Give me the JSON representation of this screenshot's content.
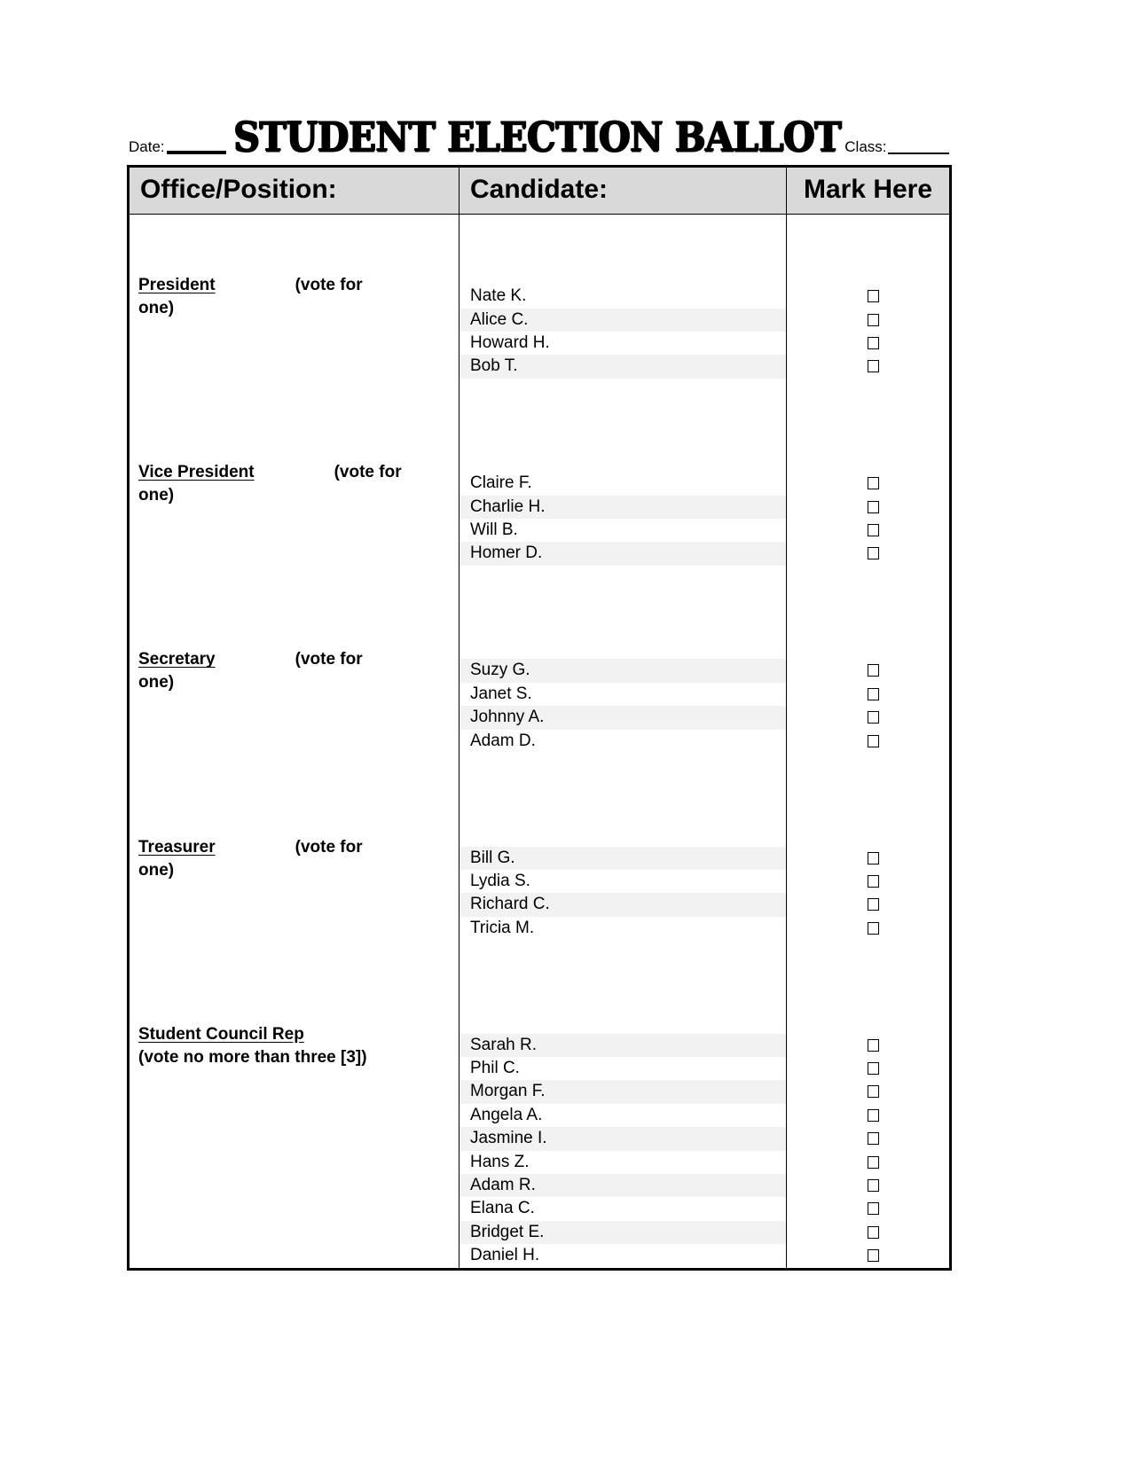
{
  "header": {
    "date_label": "Date:",
    "title": "STUDENT ELECTION BALLOT",
    "class_label": "Class:"
  },
  "table": {
    "columns": {
      "office": "Office/Position:",
      "candidate": "Candidate:",
      "mark": "Mark Here"
    },
    "sections": [
      {
        "office": "President",
        "note": "(vote for",
        "note_line2": "one)",
        "lead_spacers": 3,
        "candidates": [
          {
            "name": "Nate K.",
            "shaded": false
          },
          {
            "name": "Alice C.",
            "shaded": true
          },
          {
            "name": "Howard H.",
            "shaded": false
          },
          {
            "name": "Bob T.",
            "shaded": true
          }
        ]
      },
      {
        "office": "Vice President",
        "note": "(vote for",
        "note_line2": "one)",
        "lead_spacers": 4,
        "candidates": [
          {
            "name": "Claire F.",
            "shaded": false
          },
          {
            "name": "Charlie H.",
            "shaded": true
          },
          {
            "name": "Will B.",
            "shaded": false
          },
          {
            "name": "Homer D.",
            "shaded": true
          }
        ]
      },
      {
        "office": "Secretary",
        "note": "(vote for",
        "note_line2": "one)",
        "lead_spacers": 4,
        "candidates": [
          {
            "name": "Suzy G.",
            "shaded": true
          },
          {
            "name": "Janet S.",
            "shaded": false
          },
          {
            "name": "Johnny A.",
            "shaded": true
          },
          {
            "name": "Adam D.",
            "shaded": false
          }
        ]
      },
      {
        "office": "Treasurer",
        "note": "(vote for",
        "note_line2": "one)",
        "lead_spacers": 4,
        "candidates": [
          {
            "name": "Bill G.",
            "shaded": true
          },
          {
            "name": "Lydia S.",
            "shaded": false
          },
          {
            "name": "Richard C.",
            "shaded": true
          },
          {
            "name": "Tricia M.",
            "shaded": false
          }
        ]
      },
      {
        "office": "Student Council Rep",
        "note": "",
        "note_line2": "(vote no more than three [3])",
        "lead_spacers": 4,
        "candidates": [
          {
            "name": "Sarah R.",
            "shaded": true
          },
          {
            "name": "Phil C.",
            "shaded": false
          },
          {
            "name": "Morgan F.",
            "shaded": true
          },
          {
            "name": "Angela A.",
            "shaded": false
          },
          {
            "name": "Jasmine I.",
            "shaded": true
          },
          {
            "name": "Hans Z.",
            "shaded": false
          },
          {
            "name": "Adam R.",
            "shaded": true
          },
          {
            "name": "Elana C.",
            "shaded": false
          },
          {
            "name": "Bridget E.",
            "shaded": true
          },
          {
            "name": "Daniel H.",
            "shaded": false
          }
        ]
      }
    ]
  }
}
